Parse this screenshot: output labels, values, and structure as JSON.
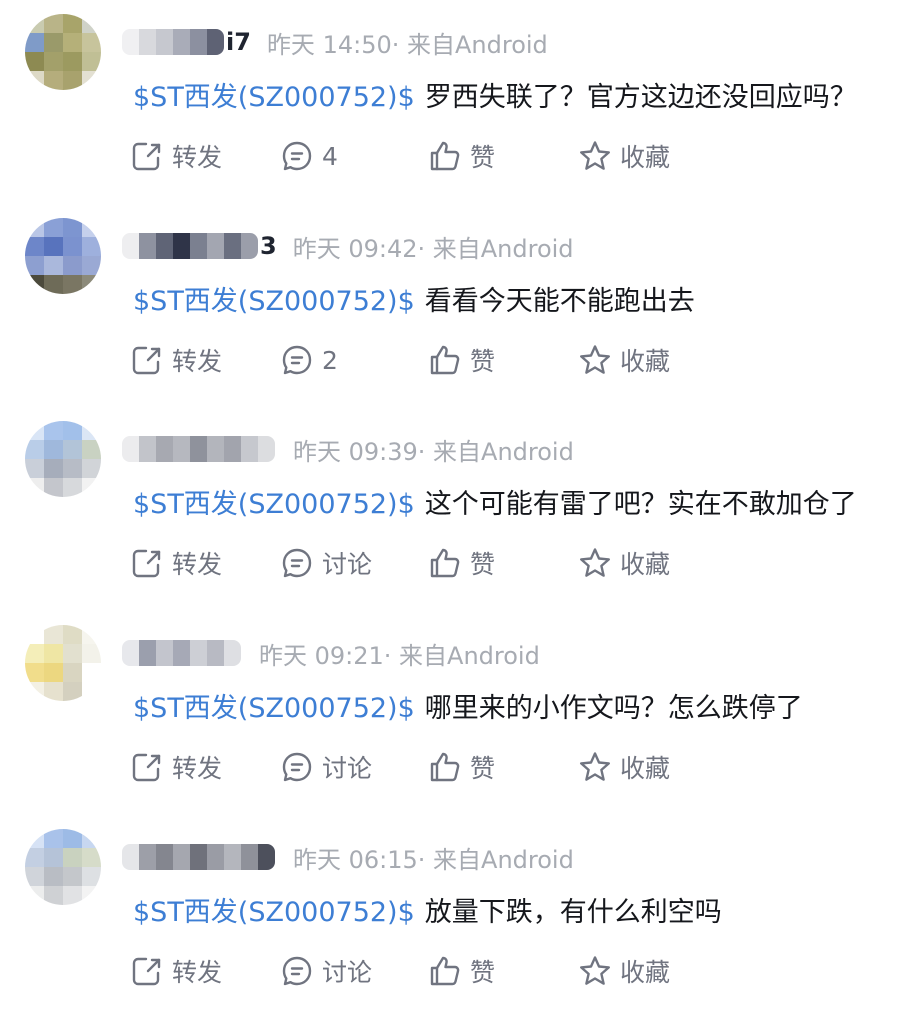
{
  "labels": {
    "share": "转发",
    "discuss": "讨论",
    "like": "赞",
    "favorite": "收藏"
  },
  "colors": {
    "stock_link": "#3d7ed4",
    "meta_text": "#a7abb2",
    "action_text": "#707480",
    "body_text": "#15171c"
  },
  "icons": [
    "share-icon",
    "comment-icon",
    "like-icon",
    "star-icon"
  ],
  "posts": [
    {
      "name_visible": "i7",
      "time": "昨天 14:50· 来自Android",
      "stock": "$ST西发(SZ000752)$",
      "text": "罗西失联了？官方这边还没回应吗？",
      "comment_label": "4"
    },
    {
      "name_visible": "3",
      "time": "昨天 09:42· 来自Android",
      "stock": "$ST西发(SZ000752)$",
      "text": "看看今天能不能跑出去",
      "comment_label": "2"
    },
    {
      "name_visible": "",
      "time": "昨天 09:39· 来自Android",
      "stock": "$ST西发(SZ000752)$",
      "text": "这个可能有雷了吧？实在不敢加仓了",
      "comment_label": "讨论"
    },
    {
      "name_visible": "",
      "time": "昨天 09:21· 来自Android",
      "stock": "$ST西发(SZ000752)$",
      "text": "哪里来的小作文吗？怎么跌停了",
      "comment_label": "讨论"
    },
    {
      "name_visible": "",
      "time": "昨天 06:15· 来自Android",
      "stock": "$ST西发(SZ000752)$",
      "text": "放量下跌，有什么利空吗",
      "comment_label": "讨论"
    }
  ]
}
